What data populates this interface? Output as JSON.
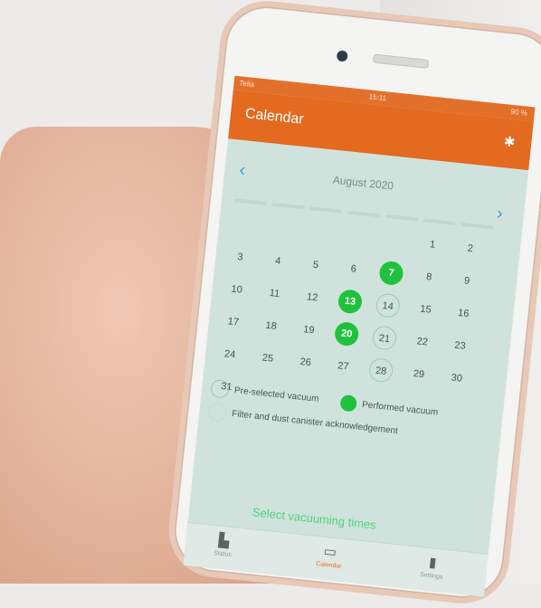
{
  "status_bar": {
    "carrier": "Telia",
    "time": "15:11",
    "battery": "90 %"
  },
  "header": {
    "title": "Calendar",
    "bluetooth_icon": "bluetooth-icon"
  },
  "calendar": {
    "month_label": "August 2020",
    "prev_icon": "chevron-left-icon",
    "next_icon": "chevron-right-icon",
    "days": [
      {
        "label": "1",
        "state": "none"
      },
      {
        "label": "2",
        "state": "none"
      },
      {
        "label": "3",
        "state": "none"
      },
      {
        "label": "4",
        "state": "none"
      },
      {
        "label": "5",
        "state": "none"
      },
      {
        "label": "6",
        "state": "none"
      },
      {
        "label": "7",
        "state": "performed"
      },
      {
        "label": "8",
        "state": "none"
      },
      {
        "label": "9",
        "state": "none"
      },
      {
        "label": "10",
        "state": "none"
      },
      {
        "label": "11",
        "state": "none"
      },
      {
        "label": "12",
        "state": "none"
      },
      {
        "label": "13",
        "state": "performed"
      },
      {
        "label": "14",
        "state": "preselected"
      },
      {
        "label": "15",
        "state": "none"
      },
      {
        "label": "16",
        "state": "none"
      },
      {
        "label": "17",
        "state": "none"
      },
      {
        "label": "18",
        "state": "none"
      },
      {
        "label": "19",
        "state": "none"
      },
      {
        "label": "20",
        "state": "performed"
      },
      {
        "label": "21",
        "state": "preselected"
      },
      {
        "label": "22",
        "state": "none"
      },
      {
        "label": "23",
        "state": "none"
      },
      {
        "label": "24",
        "state": "none"
      },
      {
        "label": "25",
        "state": "none"
      },
      {
        "label": "26",
        "state": "none"
      },
      {
        "label": "27",
        "state": "none"
      },
      {
        "label": "28",
        "state": "preselected"
      },
      {
        "label": "29",
        "state": "none"
      },
      {
        "label": "30",
        "state": "none"
      },
      {
        "label": "31",
        "state": "none"
      }
    ]
  },
  "legend": {
    "preselected": "Pre-selected vacuum",
    "performed": "Performed vacuum",
    "filter": "Filter and dust canister acknowledgement"
  },
  "select_link": "Select vacuuming times",
  "tabs": [
    {
      "label": "Status",
      "icon": "chart-icon"
    },
    {
      "label": "Calendar",
      "icon": "calendar-icon"
    },
    {
      "label": "Settings",
      "icon": "settings-icon"
    }
  ],
  "colors": {
    "header": "#e36a1f",
    "performed": "#20c23d",
    "preselected_ring": "#9cc9b5",
    "link": "#4fd37a"
  }
}
